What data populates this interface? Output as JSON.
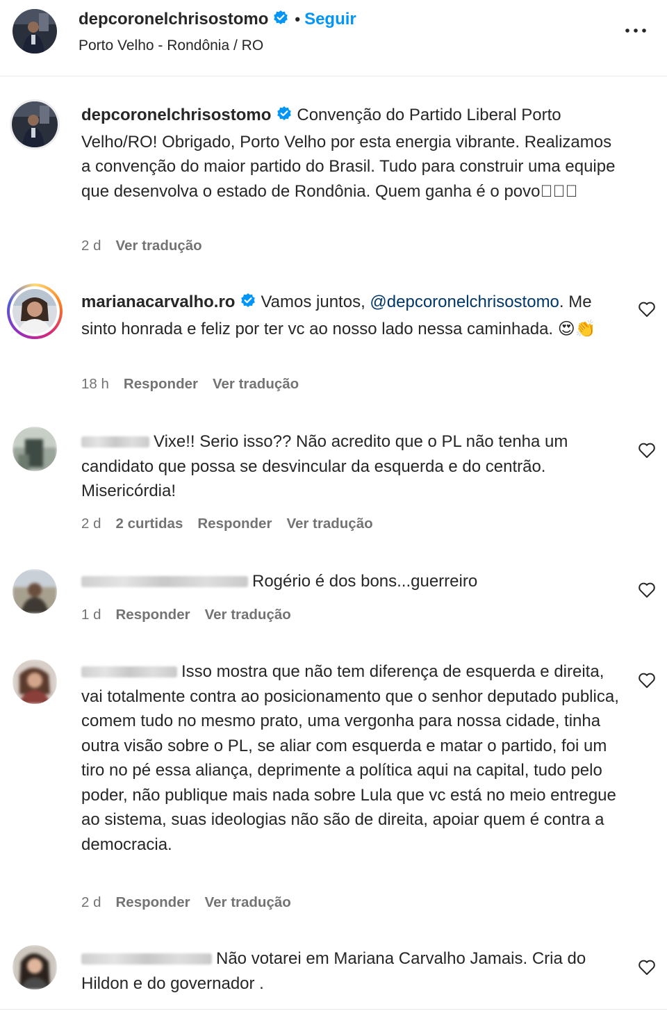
{
  "header": {
    "username": "depcoronelchrisostomo",
    "separator": "•",
    "follow_label": "Seguir",
    "location": "Porto Velho - Rondônia / RO"
  },
  "caption": {
    "username": "depcoronelchrisostomo",
    "text": "Convenção do Partido Liberal Porto Velho/RO! Obrigado, Porto Velho por esta energia vibrante. Realizamos a convenção do maior partido do Brasil. Tudo para construir uma equipe que desenvolva o estado de Rondônia. Quem ganha é o povo\u0000\u0000\u0000",
    "time": "2 d",
    "translate_label": "Ver tradução"
  },
  "comments": [
    {
      "username": "marianacarvalho.ro",
      "text_before": "Vamos juntos,",
      "mention": "@depcoronelchrisostomo",
      "text_after": ". Me sinto honrada e feliz por ter vc ao nosso lado nessa caminhada. 😍👏",
      "time": "18 h",
      "reply_label": "Responder",
      "translate_label": "Ver tradução"
    },
    {
      "text": "Vixe!! Serio isso?? Não acredito que o PL não tenha um candidato que possa se desvincular da esquerda e do centrão. Misericórdia!",
      "time": "2 d",
      "likes": "2 curtidas",
      "reply_label": "Responder",
      "translate_label": "Ver tradução"
    },
    {
      "text": "Rogério é dos bons...guerreiro",
      "time": "1 d",
      "reply_label": "Responder",
      "translate_label": "Ver tradução"
    },
    {
      "text": "Isso mostra que não tem diferença de esquerda e direita, vai totalmente contra ao posicionamento que o senhor deputado publica, comem tudo no mesmo prato, uma vergonha para nossa cidade, tinha outra visão sobre o PL, se aliar com esquerda e matar o partido, foi um tiro no pé essa aliança, deprimente a política aqui na capital, tudo pelo poder, não publique mais nada sobre Lula que vc está no meio entregue ao sistema, suas ideologias não são de direita, apoiar quem é contra a democracia.",
      "time": "2 d",
      "reply_label": "Responder",
      "translate_label": "Ver tradução"
    },
    {
      "text": "Não votarei em Mariana Carvalho Jamais. Cria do Hildon e do governador ."
    }
  ],
  "colors": {
    "accent": "#0095f6",
    "text": "#262626",
    "secondary": "#737373",
    "mention": "#00376b",
    "verified": "#0095f6"
  },
  "icons": {
    "verified": "verified-badge-icon",
    "more": "more-options-icon",
    "heart": "heart-outline-icon"
  }
}
